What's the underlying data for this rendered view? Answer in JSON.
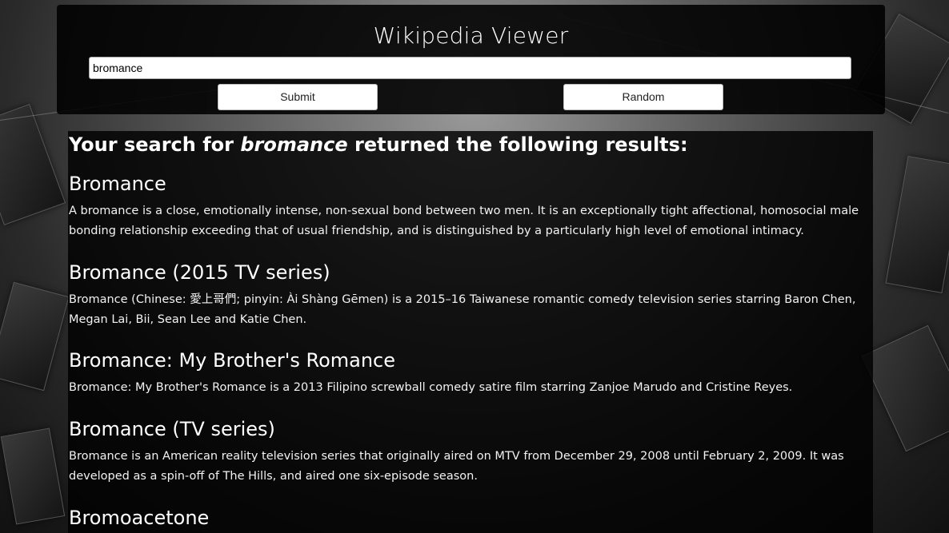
{
  "app": {
    "title": "Wikipedia Viewer"
  },
  "search": {
    "value": "bromance",
    "submit_label": "Submit",
    "random_label": "Random"
  },
  "results": {
    "heading_prefix": "Your search for ",
    "heading_query": "bromance",
    "heading_suffix": " returned the following results:",
    "items": [
      {
        "title": "Bromance",
        "snippet": "A bromance is a close, emotionally intense, non-sexual bond between two men. It is an exceptionally tight affectional, homosocial male bonding relationship exceeding that of usual friendship, and is distinguished by a particularly high level of emotional intimacy."
      },
      {
        "title": "Bromance (2015 TV series)",
        "snippet": "Bromance (Chinese: 愛上哥們; pinyin: Ài Shàng Gēmen) is a 2015–16 Taiwanese romantic comedy television series starring Baron Chen, Megan Lai, Bii, Sean Lee and Katie Chen."
      },
      {
        "title": "Bromance: My Brother's Romance",
        "snippet": "Bromance: My Brother's Romance is a 2013 Filipino screwball comedy satire film starring Zanjoe Marudo and Cristine Reyes."
      },
      {
        "title": "Bromance (TV series)",
        "snippet": "Bromance is an American reality television series that originally aired on MTV from December 29, 2008 until February 2, 2009. It was developed as a spin-off of The Hills, and aired one six-episode season."
      },
      {
        "title": "Bromoacetone",
        "snippet": ""
      }
    ]
  }
}
